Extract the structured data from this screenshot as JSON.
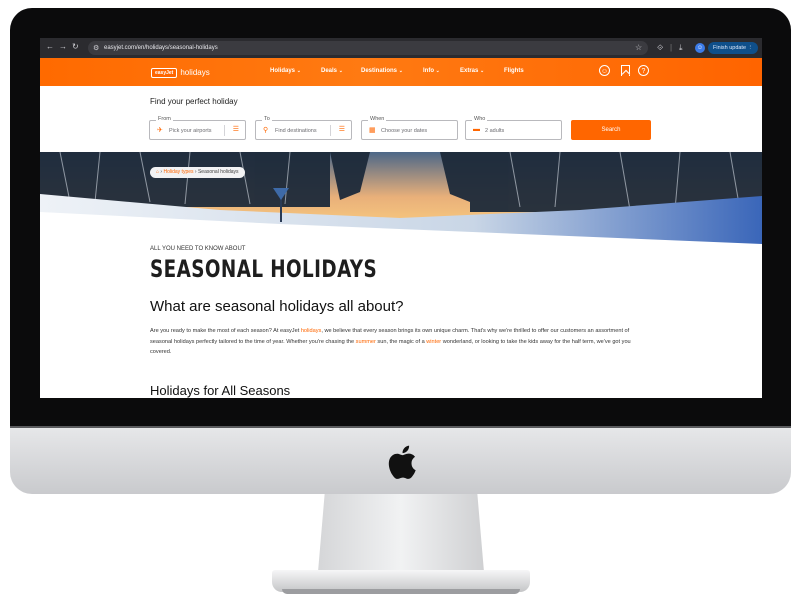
{
  "browser": {
    "url": "easyjet.com/en/holidays/seasonal-holidays",
    "finish_update": "Finish update"
  },
  "site": {
    "brand_logo": "easyJet",
    "brand_suffix": "holidays",
    "nav": [
      {
        "label": "Holidays",
        "chevron": true
      },
      {
        "label": "Deals",
        "chevron": true
      },
      {
        "label": "Destinations",
        "chevron": true
      },
      {
        "label": "Info",
        "chevron": true
      },
      {
        "label": "Extras",
        "chevron": true
      },
      {
        "label": "Flights",
        "chevron": false
      }
    ],
    "nav_icons": [
      "account-icon",
      "bookmark-icon",
      "help-icon"
    ],
    "accent": "#ff6600"
  },
  "search": {
    "title": "Find your perfect holiday",
    "from": {
      "label": "From",
      "placeholder": "Pick your airports"
    },
    "to": {
      "label": "To",
      "placeholder": "Find destinations"
    },
    "when": {
      "label": "When",
      "placeholder": "Choose your dates"
    },
    "who": {
      "label": "Who",
      "value": "2 adults"
    },
    "button": "Search"
  },
  "breadcrumb": {
    "link": "Holiday types",
    "current": "Seasonal holidays"
  },
  "article": {
    "kicker": "ALL YOU NEED TO KNOW ABOUT",
    "title": "SEASONAL HOLIDAYS",
    "h2": "What are seasonal holidays all about?",
    "p_1": "Are you ready to make the most of each season? At easyJet ",
    "p_link_holidays": "holidays",
    "p_2": ", we believe that every season brings its own unique charm. That's why we're thrilled to offer our customers an assortment of seasonal holidays perfectly tailored to the time of year. Whether you're chasing the ",
    "p_link_summer": "summer",
    "p_3": " sun, the magic of a ",
    "p_link_winter": "winter",
    "p_4": " wonderland, or looking to take the kids away for the half term, we've got you covered.",
    "h3": "Holidays for All Seasons"
  }
}
